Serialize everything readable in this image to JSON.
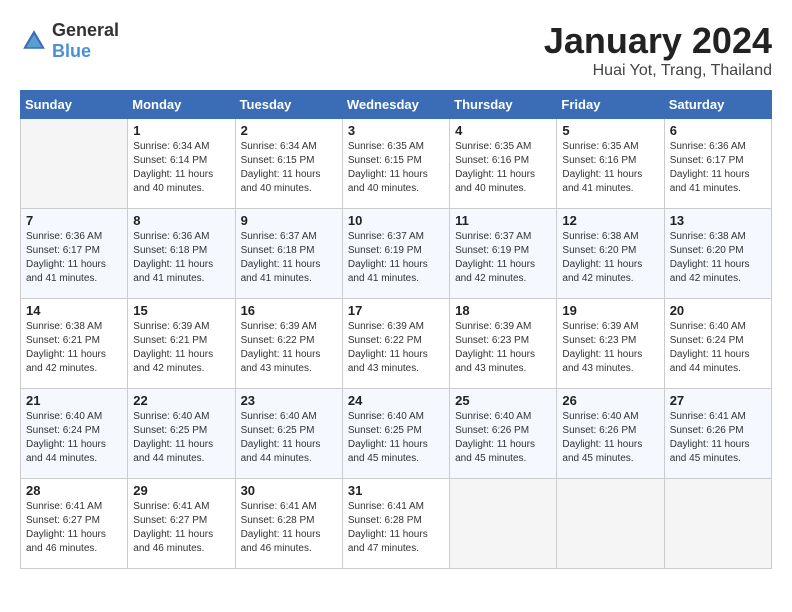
{
  "header": {
    "logo_general": "General",
    "logo_blue": "Blue",
    "month_year": "January 2024",
    "location": "Huai Yot, Trang, Thailand"
  },
  "weekdays": [
    "Sunday",
    "Monday",
    "Tuesday",
    "Wednesday",
    "Thursday",
    "Friday",
    "Saturday"
  ],
  "weeks": [
    [
      {
        "day": "",
        "empty": true
      },
      {
        "day": "1",
        "sunrise": "Sunrise: 6:34 AM",
        "sunset": "Sunset: 6:14 PM",
        "daylight": "Daylight: 11 hours and 40 minutes."
      },
      {
        "day": "2",
        "sunrise": "Sunrise: 6:34 AM",
        "sunset": "Sunset: 6:15 PM",
        "daylight": "Daylight: 11 hours and 40 minutes."
      },
      {
        "day": "3",
        "sunrise": "Sunrise: 6:35 AM",
        "sunset": "Sunset: 6:15 PM",
        "daylight": "Daylight: 11 hours and 40 minutes."
      },
      {
        "day": "4",
        "sunrise": "Sunrise: 6:35 AM",
        "sunset": "Sunset: 6:16 PM",
        "daylight": "Daylight: 11 hours and 40 minutes."
      },
      {
        "day": "5",
        "sunrise": "Sunrise: 6:35 AM",
        "sunset": "Sunset: 6:16 PM",
        "daylight": "Daylight: 11 hours and 41 minutes."
      },
      {
        "day": "6",
        "sunrise": "Sunrise: 6:36 AM",
        "sunset": "Sunset: 6:17 PM",
        "daylight": "Daylight: 11 hours and 41 minutes."
      }
    ],
    [
      {
        "day": "7",
        "sunrise": "Sunrise: 6:36 AM",
        "sunset": "Sunset: 6:17 PM",
        "daylight": "Daylight: 11 hours and 41 minutes."
      },
      {
        "day": "8",
        "sunrise": "Sunrise: 6:36 AM",
        "sunset": "Sunset: 6:18 PM",
        "daylight": "Daylight: 11 hours and 41 minutes."
      },
      {
        "day": "9",
        "sunrise": "Sunrise: 6:37 AM",
        "sunset": "Sunset: 6:18 PM",
        "daylight": "Daylight: 11 hours and 41 minutes."
      },
      {
        "day": "10",
        "sunrise": "Sunrise: 6:37 AM",
        "sunset": "Sunset: 6:19 PM",
        "daylight": "Daylight: 11 hours and 41 minutes."
      },
      {
        "day": "11",
        "sunrise": "Sunrise: 6:37 AM",
        "sunset": "Sunset: 6:19 PM",
        "daylight": "Daylight: 11 hours and 42 minutes."
      },
      {
        "day": "12",
        "sunrise": "Sunrise: 6:38 AM",
        "sunset": "Sunset: 6:20 PM",
        "daylight": "Daylight: 11 hours and 42 minutes."
      },
      {
        "day": "13",
        "sunrise": "Sunrise: 6:38 AM",
        "sunset": "Sunset: 6:20 PM",
        "daylight": "Daylight: 11 hours and 42 minutes."
      }
    ],
    [
      {
        "day": "14",
        "sunrise": "Sunrise: 6:38 AM",
        "sunset": "Sunset: 6:21 PM",
        "daylight": "Daylight: 11 hours and 42 minutes."
      },
      {
        "day": "15",
        "sunrise": "Sunrise: 6:39 AM",
        "sunset": "Sunset: 6:21 PM",
        "daylight": "Daylight: 11 hours and 42 minutes."
      },
      {
        "day": "16",
        "sunrise": "Sunrise: 6:39 AM",
        "sunset": "Sunset: 6:22 PM",
        "daylight": "Daylight: 11 hours and 43 minutes."
      },
      {
        "day": "17",
        "sunrise": "Sunrise: 6:39 AM",
        "sunset": "Sunset: 6:22 PM",
        "daylight": "Daylight: 11 hours and 43 minutes."
      },
      {
        "day": "18",
        "sunrise": "Sunrise: 6:39 AM",
        "sunset": "Sunset: 6:23 PM",
        "daylight": "Daylight: 11 hours and 43 minutes."
      },
      {
        "day": "19",
        "sunrise": "Sunrise: 6:39 AM",
        "sunset": "Sunset: 6:23 PM",
        "daylight": "Daylight: 11 hours and 43 minutes."
      },
      {
        "day": "20",
        "sunrise": "Sunrise: 6:40 AM",
        "sunset": "Sunset: 6:24 PM",
        "daylight": "Daylight: 11 hours and 44 minutes."
      }
    ],
    [
      {
        "day": "21",
        "sunrise": "Sunrise: 6:40 AM",
        "sunset": "Sunset: 6:24 PM",
        "daylight": "Daylight: 11 hours and 44 minutes."
      },
      {
        "day": "22",
        "sunrise": "Sunrise: 6:40 AM",
        "sunset": "Sunset: 6:25 PM",
        "daylight": "Daylight: 11 hours and 44 minutes."
      },
      {
        "day": "23",
        "sunrise": "Sunrise: 6:40 AM",
        "sunset": "Sunset: 6:25 PM",
        "daylight": "Daylight: 11 hours and 44 minutes."
      },
      {
        "day": "24",
        "sunrise": "Sunrise: 6:40 AM",
        "sunset": "Sunset: 6:25 PM",
        "daylight": "Daylight: 11 hours and 45 minutes."
      },
      {
        "day": "25",
        "sunrise": "Sunrise: 6:40 AM",
        "sunset": "Sunset: 6:26 PM",
        "daylight": "Daylight: 11 hours and 45 minutes."
      },
      {
        "day": "26",
        "sunrise": "Sunrise: 6:40 AM",
        "sunset": "Sunset: 6:26 PM",
        "daylight": "Daylight: 11 hours and 45 minutes."
      },
      {
        "day": "27",
        "sunrise": "Sunrise: 6:41 AM",
        "sunset": "Sunset: 6:26 PM",
        "daylight": "Daylight: 11 hours and 45 minutes."
      }
    ],
    [
      {
        "day": "28",
        "sunrise": "Sunrise: 6:41 AM",
        "sunset": "Sunset: 6:27 PM",
        "daylight": "Daylight: 11 hours and 46 minutes."
      },
      {
        "day": "29",
        "sunrise": "Sunrise: 6:41 AM",
        "sunset": "Sunset: 6:27 PM",
        "daylight": "Daylight: 11 hours and 46 minutes."
      },
      {
        "day": "30",
        "sunrise": "Sunrise: 6:41 AM",
        "sunset": "Sunset: 6:28 PM",
        "daylight": "Daylight: 11 hours and 46 minutes."
      },
      {
        "day": "31",
        "sunrise": "Sunrise: 6:41 AM",
        "sunset": "Sunset: 6:28 PM",
        "daylight": "Daylight: 11 hours and 47 minutes."
      },
      {
        "day": "",
        "empty": true
      },
      {
        "day": "",
        "empty": true
      },
      {
        "day": "",
        "empty": true
      }
    ]
  ]
}
